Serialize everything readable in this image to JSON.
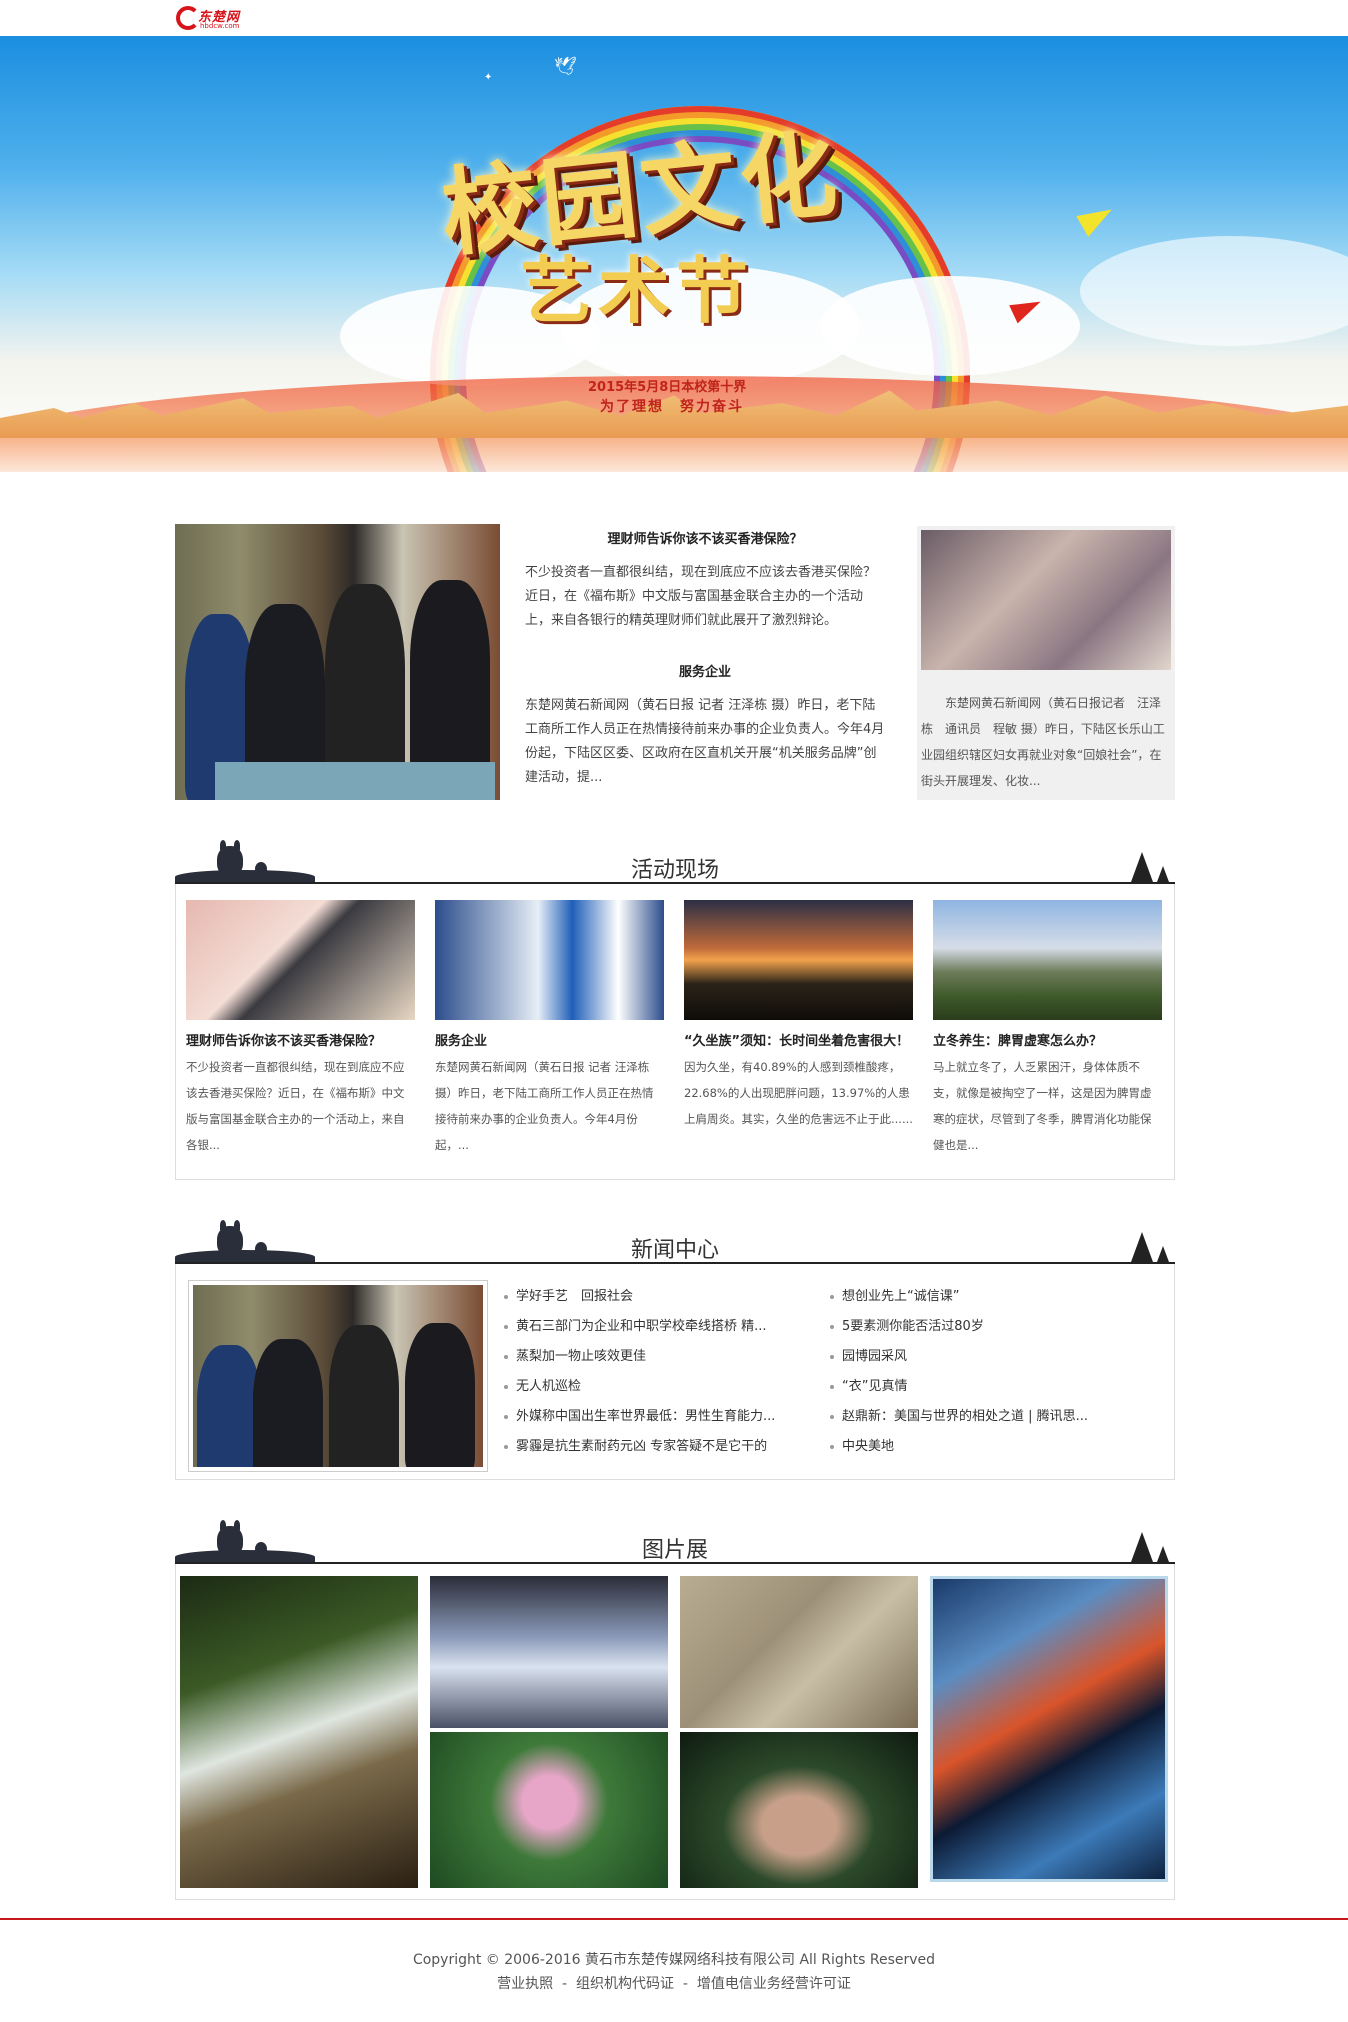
{
  "header": {
    "logo_text": "东楚网",
    "logo_sub": "hbdcw.com"
  },
  "banner": {
    "title_line1": "校园文化",
    "title_line2": "艺术节",
    "date_line": "2015年5月8日本校第十界",
    "slogan": "为了理想　努力奋斗"
  },
  "top_news": {
    "article1": {
      "title": "理财师告诉你该不该买香港保险？",
      "summary": "不少投资者一直都很纠结，现在到底应不应该去香港买保险？近日，在《福布斯》中文版与富国基金联合主办的一个活动上，来自各银行的精英理财师们就此展开了激烈辩论。"
    },
    "article2": {
      "title": "服务企业",
      "summary": "东楚网黄石新闻网（黄石日报 记者 汪泽栋 摄）昨日，老下陆工商所工作人员正在热情接待前来办事的企业负责人。今年4月份起，下陆区区委、区政府在区直机关开展“机关服务品牌”创建活动，提..."
    },
    "side": {
      "summary": "东楚网黄石新闻网（黄石日报记者　汪泽栋　通讯员　程敏 摄）昨日，下陆区长乐山工业园组织辖区妇女再就业对象“回娘社会”，在街头开展理发、化妆..."
    }
  },
  "sections": {
    "activity_title": "活动现场",
    "news_title": "新闻中心",
    "gallery_title": "图片展"
  },
  "activity": [
    {
      "title": "理财师告诉你该不该买香港保险？",
      "summary": "不少投资者一直都很纠结，现在到底应不应该去香港买保险？近日，在《福布斯》中文版与富国基金联合主办的一个活动上，来自各银..."
    },
    {
      "title": "服务企业",
      "summary": "东楚网黄石新闻网（黄石日报 记者 汪泽栋 摄）昨日，老下陆工商所工作人员正在热情接待前来办事的企业负责人。今年4月份起，..."
    },
    {
      "title": "“久坐族”须知：长时间坐着危害很大！",
      "summary": "因为久坐，有40.89%的人感到颈椎酸疼，22.68%的人出现肥胖问题，13.97%的人患上肩周炎。其实，久坐的危害远不止于此......"
    },
    {
      "title": "立冬养生：脾胃虚寒怎么办？",
      "summary": "马上就立冬了，人乏累困汗，身体体质不支，就像是被掏空了一样，这是因为脾胃虚寒的症状，尽管到了冬季，脾胃消化功能保健也是..."
    }
  ],
  "news_center": {
    "left_list": [
      "学好手艺　回报社会",
      "黄石三部门为企业和中职学校牵线搭桥 精...",
      "蒸梨加一物止咳效更佳",
      "无人机巡检",
      "外媒称中国出生率世界最低：男性生育能力...",
      "雾霾是抗生素耐药元凶 专家答疑不是它干的"
    ],
    "right_list": [
      "想创业先上“诚信课”",
      "5要素测你能否活过80岁",
      "园博园采风",
      "“衣”见真情",
      "赵鼎新：美国与世界的相处之道 | 腾讯思...",
      "中央美地"
    ]
  },
  "footer": {
    "copyright": "Copyright © 2006-2016 黄石市东楚传媒网络科技有限公司 All Rights Reserved",
    "link1": "营业执照",
    "link2": "组织机构代码证",
    "link3": "增值电信业务经营许可证",
    "sep": "-"
  }
}
